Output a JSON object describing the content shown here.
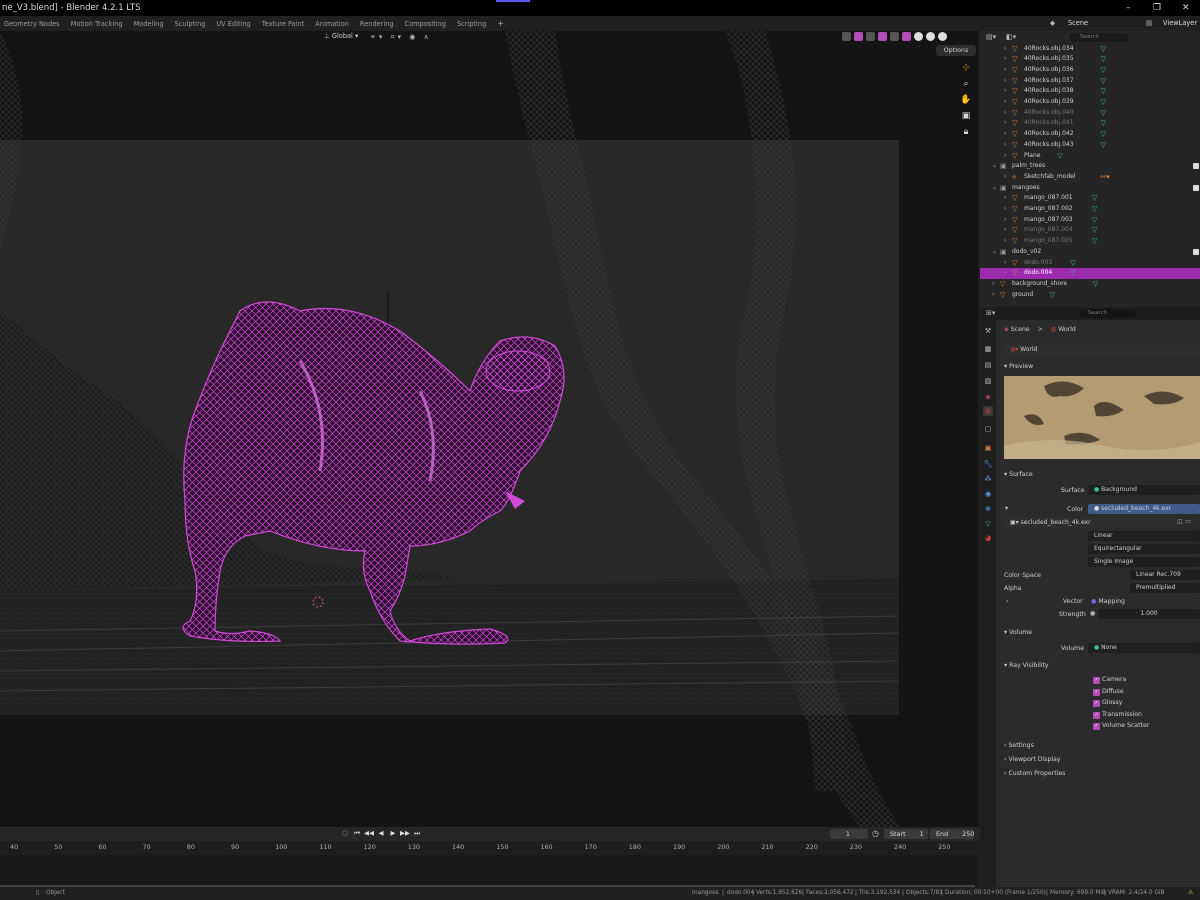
{
  "window": {
    "title": "ne_V3.blend] - Blender 4.2.1 LTS",
    "controls": [
      "–",
      "❐",
      "✕"
    ]
  },
  "workspaces": [
    "Geometry Nodes",
    "Motion Tracking",
    "Modeling",
    "Sculpting",
    "UV Editing",
    "Texture Paint",
    "Animation",
    "Rendering",
    "Compositing",
    "Scripting",
    "+"
  ],
  "top_right": {
    "scene": "Scene",
    "view_layer": "ViewLayer"
  },
  "viewport": {
    "orientation": "Global",
    "options": "Options",
    "bg_color": "#141414",
    "wire_color": "#d24ad8"
  },
  "outliner": {
    "search_placeholder": "Search",
    "rows": [
      {
        "label": "40Rocks.obj.034",
        "indent": 1,
        "icon": "mesh",
        "dim": false
      },
      {
        "label": "40Rocks.obj.035",
        "indent": 1,
        "icon": "mesh",
        "dim": false
      },
      {
        "label": "40Rocks.obj.036",
        "indent": 1,
        "icon": "mesh",
        "dim": false
      },
      {
        "label": "40Rocks.obj.037",
        "indent": 1,
        "icon": "mesh",
        "dim": false
      },
      {
        "label": "40Rocks.obj.038",
        "indent": 1,
        "icon": "mesh",
        "dim": false
      },
      {
        "label": "40Rocks.obj.039",
        "indent": 1,
        "icon": "mesh",
        "dim": false
      },
      {
        "label": "40Rocks.obj.040",
        "indent": 1,
        "icon": "mesh",
        "dim": true
      },
      {
        "label": "40Rocks.obj.041",
        "indent": 1,
        "icon": "mesh",
        "dim": true
      },
      {
        "label": "40Rocks.obj.042",
        "indent": 1,
        "icon": "mesh",
        "dim": false
      },
      {
        "label": "40Rocks.obj.043",
        "indent": 1,
        "icon": "mesh",
        "dim": false
      },
      {
        "label": "Plane",
        "indent": 1,
        "icon": "mesh",
        "dim": false
      },
      {
        "label": "palm_trees",
        "indent": 0,
        "icon": "collection",
        "dim": false
      },
      {
        "label": "Sketchfab_model",
        "indent": 1,
        "icon": "empty",
        "dim": false
      },
      {
        "label": "mangoes",
        "indent": 0,
        "icon": "collection",
        "dim": false
      },
      {
        "label": "mango_087.001",
        "indent": 1,
        "icon": "mesh",
        "dim": false
      },
      {
        "label": "mango_087.002",
        "indent": 1,
        "icon": "mesh",
        "dim": false
      },
      {
        "label": "mango_087.003",
        "indent": 1,
        "icon": "mesh",
        "dim": false
      },
      {
        "label": "mango_087.004",
        "indent": 1,
        "icon": "mesh",
        "dim": true
      },
      {
        "label": "mango_087.005",
        "indent": 1,
        "icon": "mesh",
        "dim": true
      },
      {
        "label": "dodo_v02",
        "indent": 0,
        "icon": "collection",
        "dim": false
      },
      {
        "label": "dodo.003",
        "indent": 1,
        "icon": "mesh",
        "dim": true
      },
      {
        "label": "dodo.004",
        "indent": 1,
        "icon": "mesh",
        "dim": false,
        "selected": true
      },
      {
        "label": "background_shore",
        "indent": 0,
        "icon": "mesh",
        "dim": false
      },
      {
        "label": "ground",
        "indent": 0,
        "icon": "mesh",
        "dim": false
      }
    ]
  },
  "properties": {
    "search_placeholder": "Search",
    "breadcrumb": {
      "scene": "Scene",
      "sep": ">",
      "world": "World"
    },
    "world_name": "World",
    "preview_label": "Preview",
    "surface_label": "Surface",
    "surface_field_label": "Surface",
    "surface_value": "Background",
    "color_label": "Color",
    "color_value": "secluded_beach_4k.exr",
    "image_name": "secluded_beach_4k.exr",
    "interp": "Linear",
    "projection": "Equirectangular",
    "source": "Single Image",
    "color_space_label": "Color Space",
    "color_space_value": "Linear Rec.709",
    "alpha_label": "Alpha",
    "alpha_value": "Premultiplied",
    "vector_label": "Vector",
    "vector_value": "Mapping",
    "strength_label": "Strength",
    "strength_value": "1.000",
    "volume_section": "Volume",
    "volume_label": "Volume",
    "volume_value": "None",
    "ray_visibility": "Ray Visibility",
    "rays": [
      "Camera",
      "Diffuse",
      "Glossy",
      "Transmission",
      "Volume Scatter"
    ],
    "settings": "Settings",
    "viewport_display": "Viewport Display",
    "custom_props": "Custom Properties"
  },
  "timeline": {
    "current_frame": "1",
    "start_label": "Start",
    "start_value": "1",
    "end_label": "End",
    "end_value": "250",
    "ruler": [
      "40",
      "50",
      "60",
      "70",
      "80",
      "90",
      "100",
      "110",
      "120",
      "130",
      "140",
      "150",
      "160",
      "170",
      "180",
      "190",
      "200",
      "210",
      "220",
      "230",
      "240",
      "250"
    ]
  },
  "status": {
    "object_mode": "Object",
    "collection": "mangoes",
    "active": "dodo.004",
    "verts": "Verts:1,952,626",
    "faces": "Faces:2,056,472",
    "tris": "Tris:3,192,534",
    "objects": "Objects:7/81",
    "duration": "Duration: 00:10+00 (Frame 1/250)",
    "memory": "Memory: 699.0 MiB",
    "vram": "VRAM: 2.4/24.0 GiB"
  }
}
